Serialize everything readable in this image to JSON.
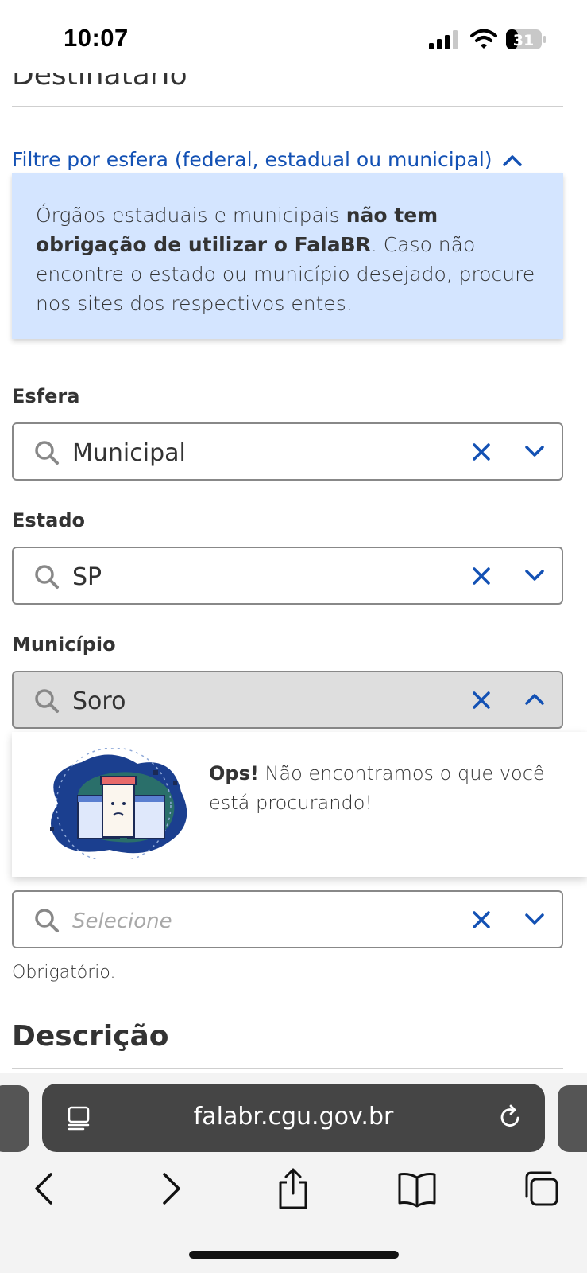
{
  "status_bar": {
    "time": "10:07",
    "battery_level": "31",
    "icons": [
      "signal-icon",
      "wifi-icon",
      "battery-icon"
    ]
  },
  "page": {
    "destinatario_title": "Destinatário",
    "filter_link": "Filtre por esfera (federal, estadual ou municipal)",
    "info_box": {
      "text_before": "Órgãos estaduais e municipais ",
      "bold_text": "não tem obrigação de utilizar o FalaBR",
      "text_after": ". Caso não encontre o estado ou município desejado, procure nos sites dos respectivos entes."
    },
    "fields": [
      {
        "label": "Esfera",
        "value": "Municipal"
      },
      {
        "label": "Estado",
        "value": "SP"
      },
      {
        "label": "Município",
        "value": "Soro"
      }
    ],
    "dropdown": {
      "bold": "Ops!",
      "message": " Não encontramos o que você está procurando!"
    },
    "orgao_select": {
      "placeholder": "Selecione"
    },
    "helper_text": "Obrigatório.",
    "descricao_title": "Descrição"
  },
  "browser": {
    "url": "falabr.cgu.gov.br",
    "nav_icons": [
      "back-icon",
      "forward-icon",
      "share-icon",
      "bookmarks-icon",
      "tabs-icon"
    ]
  },
  "colors": {
    "accent": "#1351b4",
    "info_bg": "#d4e5ff",
    "address_bar": "#454545"
  }
}
